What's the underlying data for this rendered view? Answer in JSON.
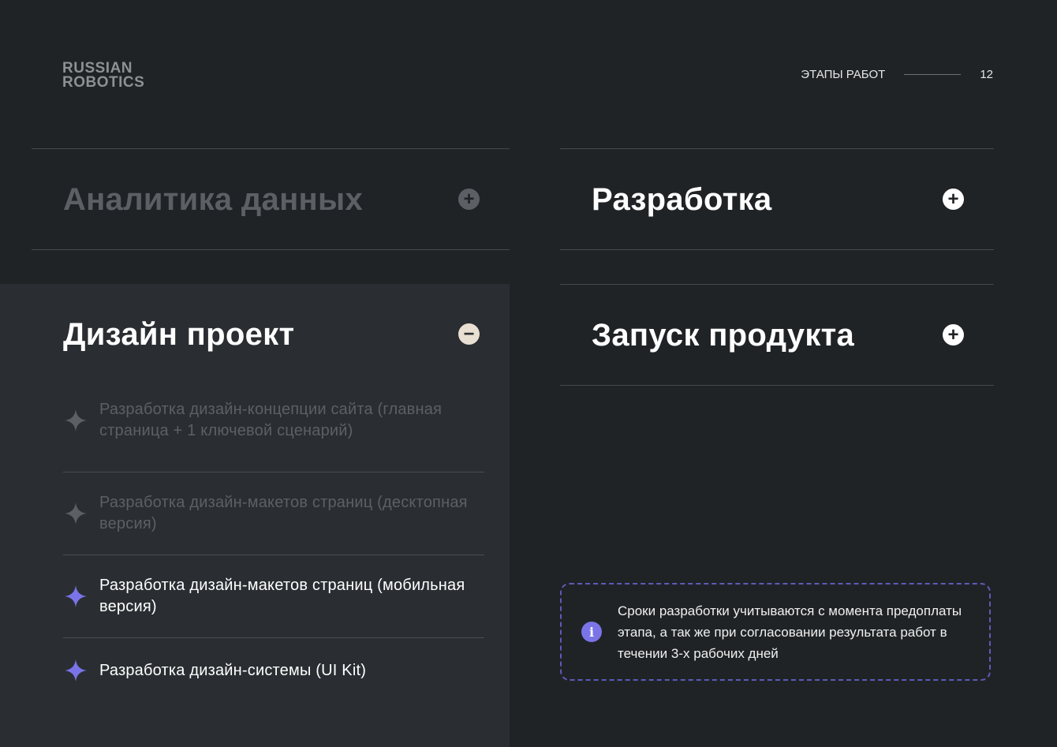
{
  "brand": {
    "line1": "RUSSIAN",
    "line2": "ROBOTICS"
  },
  "header": {
    "section": "ЭТАПЫ РАБОТ",
    "page_number": "12"
  },
  "accordion": {
    "analytics": {
      "title": "Аналитика данных",
      "icon": "plus-circle-icon",
      "state": "collapsed"
    },
    "development": {
      "title": "Разработка",
      "icon": "plus-circle-icon",
      "state": "collapsed"
    },
    "design": {
      "title": "Дизайн проект",
      "icon": "minus-circle-icon",
      "state": "expanded",
      "items": [
        {
          "text": "Разработка дизайн-концепции сайта (главная страница + 1 ключевой сценарий)",
          "status": "done"
        },
        {
          "text": "Разработка дизайн-макетов страниц (десктопная версия)",
          "status": "done"
        },
        {
          "text": "Разработка дизайн-макетов страниц (мобильная версия)",
          "status": "active"
        },
        {
          "text": "Разработка дизайн-системы (UI Kit)",
          "status": "active"
        }
      ]
    },
    "launch": {
      "title": "Запуск продукта",
      "icon": "plus-circle-icon",
      "state": "collapsed"
    }
  },
  "note": {
    "icon": "info-icon",
    "text": "Сроки разработки учитываются с момента предоплаты этапа,  а так же при согласовании результата работ в течении 3-х рабочих дней"
  },
  "colors": {
    "background": "#202326",
    "panel": "#2a2e32",
    "accent": "#7a74e8",
    "muted_text": "#5c6065",
    "minus_icon_bg": "#e9dfd2"
  }
}
